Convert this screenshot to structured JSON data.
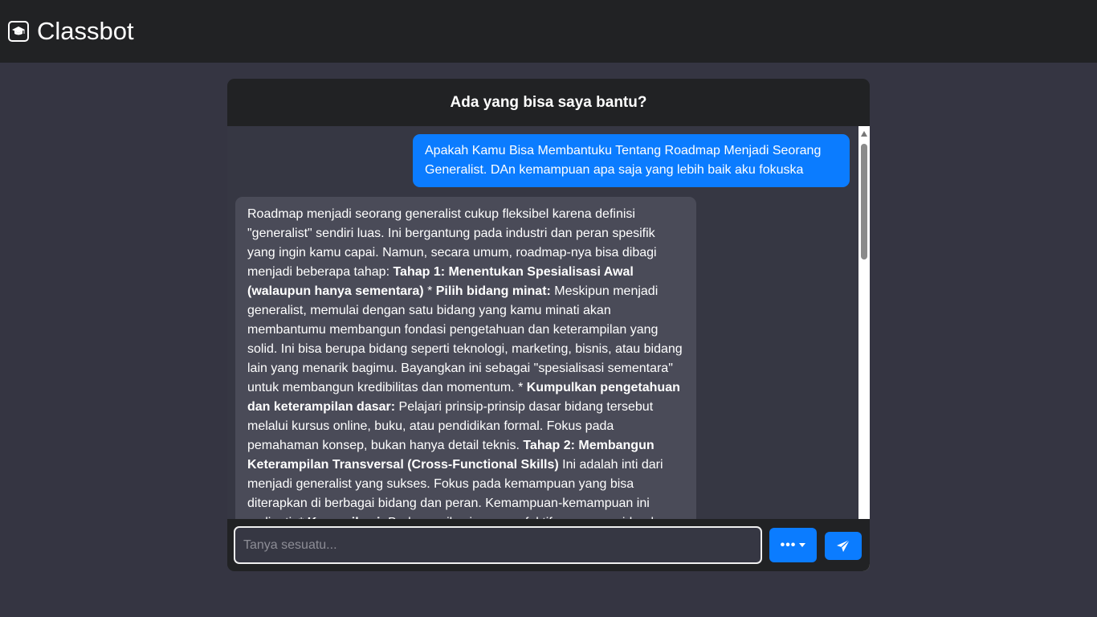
{
  "app": {
    "name": "Classbot",
    "logo_icon": "graduation-cap-icon"
  },
  "chat": {
    "title": "Ada yang bisa saya bantu?",
    "user_message": "Apakah Kamu Bisa Membantuku Tentang Roadmap Menjadi Seorang Generalist. DAn kemampuan apa saja yang lebih baik aku fokuska",
    "bot_message": [
      {
        "text": "Roadmap menjadi seorang generalist cukup fleksibel karena definisi \"generalist\" sendiri luas. Ini bergantung pada industri dan peran spesifik yang ingin kamu capai. Namun, secara umum, roadmap-nya bisa dibagi menjadi beberapa tahap: ",
        "bold": false
      },
      {
        "text": "Tahap 1: Menentukan Spesialisasi Awal (walaupun hanya sementara)",
        "bold": true
      },
      {
        "text": " * ",
        "bold": false
      },
      {
        "text": "Pilih bidang minat:",
        "bold": true
      },
      {
        "text": " Meskipun menjadi generalist, memulai dengan satu bidang yang kamu minati akan membantumu membangun fondasi pengetahuan dan keterampilan yang solid. Ini bisa berupa bidang seperti teknologi, marketing, bisnis, atau bidang lain yang menarik bagimu. Bayangkan ini sebagai \"spesialisasi sementara\" untuk membangun kredibilitas dan momentum. * ",
        "bold": false
      },
      {
        "text": "Kumpulkan pengetahuan dan keterampilan dasar:",
        "bold": true
      },
      {
        "text": " Pelajari prinsip-prinsip dasar bidang tersebut melalui kursus online, buku, atau pendidikan formal. Fokus pada pemahaman konsep, bukan hanya detail teknis. ",
        "bold": false
      },
      {
        "text": "Tahap 2: Membangun Keterampilan Transversal (Cross-Functional Skills)",
        "bold": true
      },
      {
        "text": " Ini adalah inti dari menjadi generalist yang sukses. Fokus pada kemampuan yang bisa diterapkan di berbagai bidang dan peran. Kemampuan-kemampuan ini meliputi: * ",
        "bold": false
      },
      {
        "text": "Komunikasi:",
        "bold": true
      },
      {
        "text": " Berkomunikasi secara efektif, menyusun ide, dan memikat audiens...",
        "bold": false
      }
    ]
  },
  "input": {
    "placeholder": "Tanya sesuatu...",
    "value": ""
  },
  "buttons": {
    "more_icon": "ellipsis-dropdown-icon",
    "send_icon": "paper-plane-icon"
  },
  "colors": {
    "navbar": "#212224",
    "page_bg": "#353542",
    "accent": "#0b7cff",
    "bot_bubble": "#4a4b58"
  }
}
